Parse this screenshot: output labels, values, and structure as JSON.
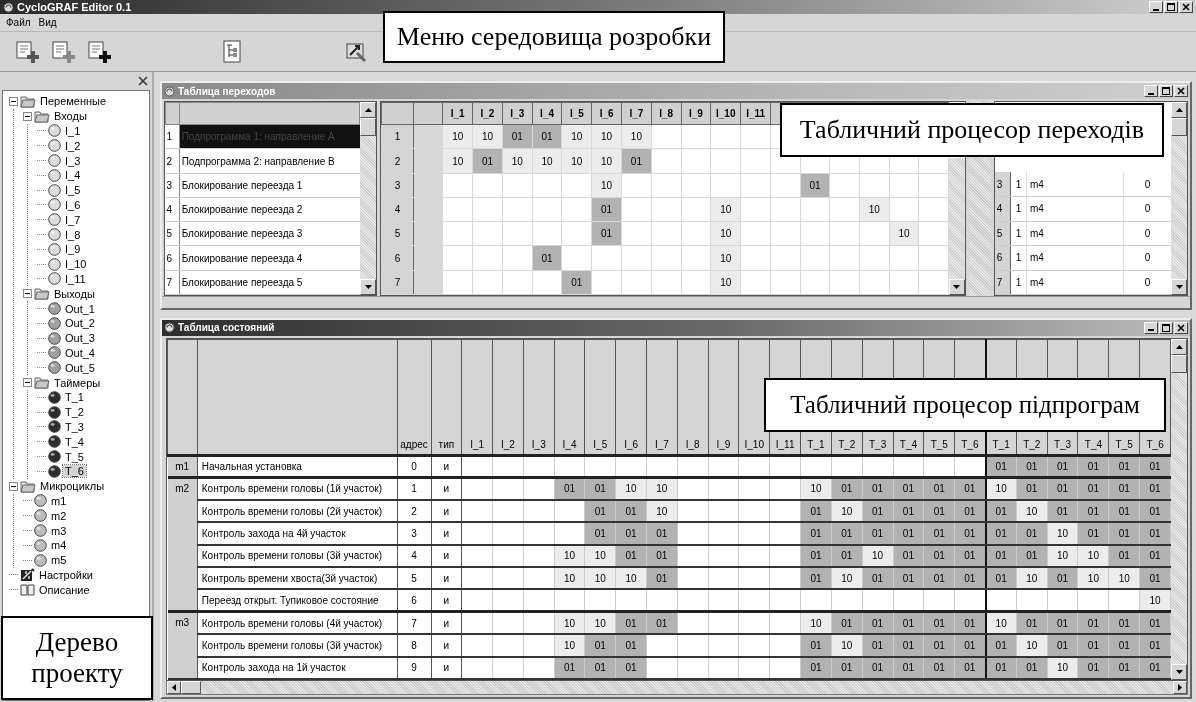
{
  "window": {
    "title": "CycloGRAF Editor 0.1"
  },
  "menu": [
    "Файл",
    "Вид"
  ],
  "callouts": {
    "menu": "Меню середовища розробки",
    "transitions": "Табличний процесор переходів",
    "subroutines": "Табличний процесор підпрограм",
    "tree": "Дерево проекту"
  },
  "tree": {
    "items": [
      {
        "label": "Переменные",
        "kind": "folder",
        "expanded": true,
        "selected": false,
        "children": [
          {
            "label": "Входы",
            "kind": "folder",
            "expanded": true,
            "selected": false,
            "children": [
              {
                "label": "I_1",
                "kind": "input",
                "selected": false
              },
              {
                "label": "I_2",
                "kind": "input",
                "selected": false
              },
              {
                "label": "I_3",
                "kind": "input",
                "selected": false
              },
              {
                "label": "I_4",
                "kind": "input",
                "selected": false
              },
              {
                "label": "I_5",
                "kind": "input",
                "selected": false
              },
              {
                "label": "I_6",
                "kind": "input",
                "selected": false
              },
              {
                "label": "I_7",
                "kind": "input",
                "selected": false
              },
              {
                "label": "I_8",
                "kind": "input",
                "selected": false
              },
              {
                "label": "I_9",
                "kind": "input",
                "selected": false
              },
              {
                "label": "I_10",
                "kind": "input",
                "selected": false
              },
              {
                "label": "I_11",
                "kind": "input",
                "selected": false
              }
            ]
          },
          {
            "label": "Выходы",
            "kind": "folder",
            "expanded": true,
            "selected": false,
            "children": [
              {
                "label": "Out_1",
                "kind": "output",
                "selected": false
              },
              {
                "label": "Out_2",
                "kind": "output",
                "selected": false
              },
              {
                "label": "Out_3",
                "kind": "output",
                "selected": false
              },
              {
                "label": "Out_4",
                "kind": "output",
                "selected": false
              },
              {
                "label": "Out_5",
                "kind": "output",
                "selected": false
              }
            ]
          },
          {
            "label": "Таймеры",
            "kind": "folder",
            "expanded": true,
            "selected": false,
            "children": [
              {
                "label": "T_1",
                "kind": "timer",
                "selected": false
              },
              {
                "label": "T_2",
                "kind": "timer",
                "selected": false
              },
              {
                "label": "T_3",
                "kind": "timer",
                "selected": false
              },
              {
                "label": "T_4",
                "kind": "timer",
                "selected": false
              },
              {
                "label": "T_5",
                "kind": "timer",
                "selected": false
              },
              {
                "label": "T_6",
                "kind": "timer",
                "selected": true
              }
            ]
          }
        ]
      },
      {
        "label": "Микроциклы",
        "kind": "folder",
        "expanded": true,
        "selected": false,
        "children": [
          {
            "label": "m1",
            "kind": "cycle",
            "selected": false
          },
          {
            "label": "m2",
            "kind": "cycle",
            "selected": false
          },
          {
            "label": "m3",
            "kind": "cycle",
            "selected": false
          },
          {
            "label": "m4",
            "kind": "cycle",
            "selected": false
          },
          {
            "label": "m5",
            "kind": "cycle",
            "selected": false
          }
        ]
      },
      {
        "label": "Настройки",
        "kind": "settings",
        "selected": false
      },
      {
        "label": "Описание",
        "kind": "description",
        "selected": false
      }
    ]
  },
  "transitions": {
    "title": "Таблица переходов",
    "programs": [
      {
        "number": "1",
        "name": "Подпрограмма 1: направление А",
        "selected": true
      },
      {
        "number": "2",
        "name": "Подпрограмма 2: направление В",
        "selected": false
      },
      {
        "number": "3",
        "name": "Блокирование переезда 1",
        "selected": false
      },
      {
        "number": "4",
        "name": "Блокирование переезда 2",
        "selected": false
      },
      {
        "number": "5",
        "name": "Блокирование переезда 3",
        "selected": false
      },
      {
        "number": "6",
        "name": "Блокирование переезда 4",
        "selected": false
      },
      {
        "number": "7",
        "name": "Блокирование переезда 5",
        "selected": false
      }
    ],
    "columns": [
      "I_1",
      "I_2",
      "I_3",
      "I_4",
      "I_5",
      "I_6",
      "I_7",
      "I_8",
      "I_9",
      "I_10",
      "I_11"
    ],
    "rows": [
      {
        "number": "1",
        "cells": [
          {
            "text": "10",
            "dark": false
          },
          {
            "text": "10",
            "dark": false
          },
          {
            "text": "01",
            "dark": true
          },
          {
            "text": "01",
            "dark": true
          },
          {
            "text": "10",
            "dark": false
          },
          {
            "text": "10",
            "dark": false
          },
          {
            "text": "10",
            "dark": false
          },
          null,
          null,
          null,
          null,
          null,
          null,
          null,
          null,
          null,
          null
        ]
      },
      {
        "number": "2",
        "cells": [
          {
            "text": "10",
            "dark": false
          },
          {
            "text": "01",
            "dark": true
          },
          {
            "text": "10",
            "dark": false
          },
          {
            "text": "10",
            "dark": false
          },
          {
            "text": "10",
            "dark": false
          },
          {
            "text": "10",
            "dark": false
          },
          {
            "text": "01",
            "dark": true
          },
          null,
          null,
          null,
          null,
          null,
          null,
          null,
          null,
          null,
          null
        ]
      },
      {
        "number": "3",
        "cells": [
          null,
          null,
          null,
          null,
          null,
          {
            "text": "10",
            "dark": false
          },
          null,
          null,
          null,
          null,
          null,
          null,
          {
            "text": "01",
            "dark": true
          },
          null,
          null,
          null,
          null
        ]
      },
      {
        "number": "4",
        "cells": [
          null,
          null,
          null,
          null,
          null,
          {
            "text": "01",
            "dark": true
          },
          null,
          null,
          null,
          {
            "text": "10",
            "dark": false
          },
          null,
          null,
          null,
          null,
          {
            "text": "10",
            "dark": false
          },
          null,
          null
        ]
      },
      {
        "number": "5",
        "cells": [
          null,
          null,
          null,
          null,
          null,
          {
            "text": "01",
            "dark": true
          },
          null,
          null,
          null,
          {
            "text": "10",
            "dark": false
          },
          null,
          null,
          null,
          null,
          null,
          {
            "text": "10",
            "dark": false
          },
          null
        ]
      },
      {
        "number": "6",
        "cells": [
          null,
          null,
          null,
          {
            "text": "01",
            "dark": true
          },
          null,
          null,
          null,
          null,
          null,
          {
            "text": "10",
            "dark": false
          },
          null,
          null,
          null,
          null,
          null,
          null,
          null
        ]
      },
      {
        "number": "7",
        "cells": [
          null,
          null,
          null,
          null,
          {
            "text": "01",
            "dark": true
          },
          null,
          null,
          null,
          null,
          {
            "text": "10",
            "dark": false
          },
          null,
          null,
          null,
          null,
          null,
          null,
          null
        ]
      }
    ],
    "links": [
      {
        "number": "3",
        "flag": "1",
        "target": "m4",
        "value": "0"
      },
      {
        "number": "4",
        "flag": "1",
        "target": "m4",
        "value": "0"
      },
      {
        "number": "5",
        "flag": "1",
        "target": "m4",
        "value": "0"
      },
      {
        "number": "6",
        "flag": "1",
        "target": "m4",
        "value": "0"
      },
      {
        "number": "7",
        "flag": "1",
        "target": "m4",
        "value": "0"
      }
    ]
  },
  "states": {
    "title": "Таблица состояний",
    "columns": [
      "адрес",
      "тип"
    ],
    "column_groups": [
      [
        "I_1",
        "I_2",
        "I_3",
        "I_4",
        "I_5",
        "I_6",
        "I_7",
        "I_8",
        "I_9",
        "I_10",
        "I_11"
      ],
      [
        "T_1",
        "T_2",
        "T_3",
        "T_4",
        "T_5",
        "T_6"
      ],
      [
        "T_1",
        "T_2",
        "T_3",
        "T_4",
        "T_5",
        "T_6"
      ]
    ],
    "groups": [
      {
        "label": "m1",
        "rows": [
          {
            "name": "Начальная установка",
            "address": "0",
            "type": "и",
            "cells": [
              null,
              null,
              null,
              null,
              null,
              null,
              null,
              null,
              null,
              null,
              null,
              null,
              null,
              null,
              null,
              null,
              null,
              {
                "text": "01",
                "dark": true
              },
              {
                "text": "01",
                "dark": true
              },
              {
                "text": "01",
                "dark": true
              },
              {
                "text": "01",
                "dark": true
              },
              {
                "text": "01",
                "dark": true
              },
              {
                "text": "01",
                "dark": true
              }
            ]
          }
        ]
      },
      {
        "label": "m2",
        "rows": [
          {
            "name": "Контроль времени головы (1й участок)",
            "address": "1",
            "type": "и",
            "cells": [
              null,
              null,
              null,
              {
                "text": "01",
                "dark": true
              },
              {
                "text": "01",
                "dark": true
              },
              {
                "text": "10",
                "dark": false
              },
              {
                "text": "10",
                "dark": false
              },
              null,
              null,
              null,
              null,
              {
                "text": "10",
                "dark": false
              },
              {
                "text": "01",
                "dark": true
              },
              {
                "text": "01",
                "dark": true
              },
              {
                "text": "01",
                "dark": true
              },
              {
                "text": "01",
                "dark": true
              },
              {
                "text": "01",
                "dark": true
              },
              {
                "text": "10",
                "dark": false
              },
              {
                "text": "01",
                "dark": true
              },
              {
                "text": "01",
                "dark": true
              },
              {
                "text": "01",
                "dark": true
              },
              {
                "text": "01",
                "dark": true
              },
              {
                "text": "01",
                "dark": true
              }
            ]
          },
          {
            "name": "Контроль времени головы (2й участок)",
            "address": "2",
            "type": "и",
            "cells": [
              null,
              null,
              null,
              null,
              {
                "text": "01",
                "dark": true
              },
              {
                "text": "01",
                "dark": true
              },
              {
                "text": "10",
                "dark": false
              },
              null,
              null,
              null,
              null,
              {
                "text": "01",
                "dark": true
              },
              {
                "text": "10",
                "dark": false
              },
              {
                "text": "01",
                "dark": true
              },
              {
                "text": "01",
                "dark": true
              },
              {
                "text": "01",
                "dark": true
              },
              {
                "text": "01",
                "dark": true
              },
              {
                "text": "01",
                "dark": true
              },
              {
                "text": "10",
                "dark": false
              },
              {
                "text": "01",
                "dark": true
              },
              {
                "text": "01",
                "dark": true
              },
              {
                "text": "01",
                "dark": true
              },
              {
                "text": "01",
                "dark": true
              }
            ]
          },
          {
            "name": "Контроль захода на 4й участок",
            "address": "3",
            "type": "и",
            "cells": [
              null,
              null,
              null,
              null,
              {
                "text": "01",
                "dark": true
              },
              {
                "text": "01",
                "dark": true
              },
              {
                "text": "01",
                "dark": true
              },
              null,
              null,
              null,
              null,
              {
                "text": "01",
                "dark": true
              },
              {
                "text": "01",
                "dark": true
              },
              {
                "text": "01",
                "dark": true
              },
              {
                "text": "01",
                "dark": true
              },
              {
                "text": "01",
                "dark": true
              },
              {
                "text": "01",
                "dark": true
              },
              {
                "text": "01",
                "dark": true
              },
              {
                "text": "01",
                "dark": true
              },
              {
                "text": "10",
                "dark": false
              },
              {
                "text": "01",
                "dark": true
              },
              {
                "text": "01",
                "dark": true
              },
              {
                "text": "01",
                "dark": true
              }
            ]
          },
          {
            "name": "Контроль времени головы (3й участок)",
            "address": "4",
            "type": "и",
            "cells": [
              null,
              null,
              null,
              {
                "text": "10",
                "dark": false
              },
              {
                "text": "10",
                "dark": false
              },
              {
                "text": "01",
                "dark": true
              },
              {
                "text": "01",
                "dark": true
              },
              null,
              null,
              null,
              null,
              {
                "text": "01",
                "dark": true
              },
              {
                "text": "01",
                "dark": true
              },
              {
                "text": "10",
                "dark": false
              },
              {
                "text": "01",
                "dark": true
              },
              {
                "text": "01",
                "dark": true
              },
              {
                "text": "01",
                "dark": true
              },
              {
                "text": "01",
                "dark": true
              },
              {
                "text": "01",
                "dark": true
              },
              {
                "text": "10",
                "dark": false
              },
              {
                "text": "10",
                "dark": false
              },
              {
                "text": "01",
                "dark": true
              },
              {
                "text": "01",
                "dark": true
              }
            ]
          },
          {
            "name": "Контроль времени хвоста(3й участок)",
            "address": "5",
            "type": "и",
            "cells": [
              null,
              null,
              null,
              {
                "text": "10",
                "dark": false
              },
              {
                "text": "10",
                "dark": false
              },
              {
                "text": "10",
                "dark": false
              },
              {
                "text": "01",
                "dark": true
              },
              null,
              null,
              null,
              null,
              {
                "text": "01",
                "dark": true
              },
              {
                "text": "10",
                "dark": false
              },
              {
                "text": "01",
                "dark": true
              },
              {
                "text": "01",
                "dark": true
              },
              {
                "text": "01",
                "dark": true
              },
              {
                "text": "01",
                "dark": true
              },
              {
                "text": "01",
                "dark": true
              },
              {
                "text": "10",
                "dark": false
              },
              {
                "text": "01",
                "dark": true
              },
              {
                "text": "10",
                "dark": false
              },
              {
                "text": "10",
                "dark": false
              },
              {
                "text": "01",
                "dark": true
              }
            ]
          },
          {
            "name": "Переезд открыт. Тупиковое состояние",
            "address": "6",
            "type": "и",
            "cells": [
              null,
              null,
              null,
              null,
              null,
              null,
              null,
              null,
              null,
              null,
              null,
              null,
              null,
              null,
              null,
              null,
              null,
              null,
              null,
              null,
              null,
              null,
              {
                "text": "10",
                "dark": false
              }
            ]
          }
        ]
      },
      {
        "label": "m3",
        "rows": [
          {
            "name": "Контроль времени головы (4й участок)",
            "address": "7",
            "type": "и",
            "cells": [
              null,
              null,
              null,
              {
                "text": "10",
                "dark": false
              },
              {
                "text": "10",
                "dark": false
              },
              {
                "text": "01",
                "dark": true
              },
              {
                "text": "01",
                "dark": true
              },
              null,
              null,
              null,
              null,
              {
                "text": "10",
                "dark": false
              },
              {
                "text": "01",
                "dark": true
              },
              {
                "text": "01",
                "dark": true
              },
              {
                "text": "01",
                "dark": true
              },
              {
                "text": "01",
                "dark": true
              },
              {
                "text": "01",
                "dark": true
              },
              {
                "text": "10",
                "dark": false
              },
              {
                "text": "01",
                "dark": true
              },
              {
                "text": "01",
                "dark": true
              },
              {
                "text": "01",
                "dark": true
              },
              {
                "text": "01",
                "dark": true
              },
              {
                "text": "01",
                "dark": true
              }
            ]
          },
          {
            "name": "Контроль времени  головы (3й участок)",
            "address": "8",
            "type": "и",
            "cells": [
              null,
              null,
              null,
              {
                "text": "10",
                "dark": false
              },
              {
                "text": "01",
                "dark": true
              },
              {
                "text": "01",
                "dark": true
              },
              null,
              null,
              null,
              null,
              null,
              {
                "text": "01",
                "dark": true
              },
              {
                "text": "10",
                "dark": false
              },
              {
                "text": "01",
                "dark": true
              },
              {
                "text": "01",
                "dark": true
              },
              {
                "text": "01",
                "dark": true
              },
              {
                "text": "01",
                "dark": true
              },
              {
                "text": "01",
                "dark": true
              },
              {
                "text": "10",
                "dark": false
              },
              {
                "text": "01",
                "dark": true
              },
              {
                "text": "01",
                "dark": true
              },
              {
                "text": "01",
                "dark": true
              },
              {
                "text": "01",
                "dark": true
              }
            ]
          },
          {
            "name": "Контроль захода на 1й участок",
            "address": "9",
            "type": "и",
            "cells": [
              null,
              null,
              null,
              {
                "text": "01",
                "dark": true
              },
              {
                "text": "01",
                "dark": true
              },
              {
                "text": "01",
                "dark": true
              },
              null,
              null,
              null,
              null,
              null,
              {
                "text": "01",
                "dark": true
              },
              {
                "text": "01",
                "dark": true
              },
              {
                "text": "01",
                "dark": true
              },
              {
                "text": "01",
                "dark": true
              },
              {
                "text": "01",
                "dark": true
              },
              {
                "text": "01",
                "dark": true
              },
              {
                "text": "01",
                "dark": true
              },
              {
                "text": "01",
                "dark": true
              },
              {
                "text": "10",
                "dark": false
              },
              {
                "text": "01",
                "dark": true
              },
              {
                "text": "01",
                "dark": true
              },
              {
                "text": "01",
                "dark": true
              }
            ]
          }
        ]
      }
    ]
  }
}
